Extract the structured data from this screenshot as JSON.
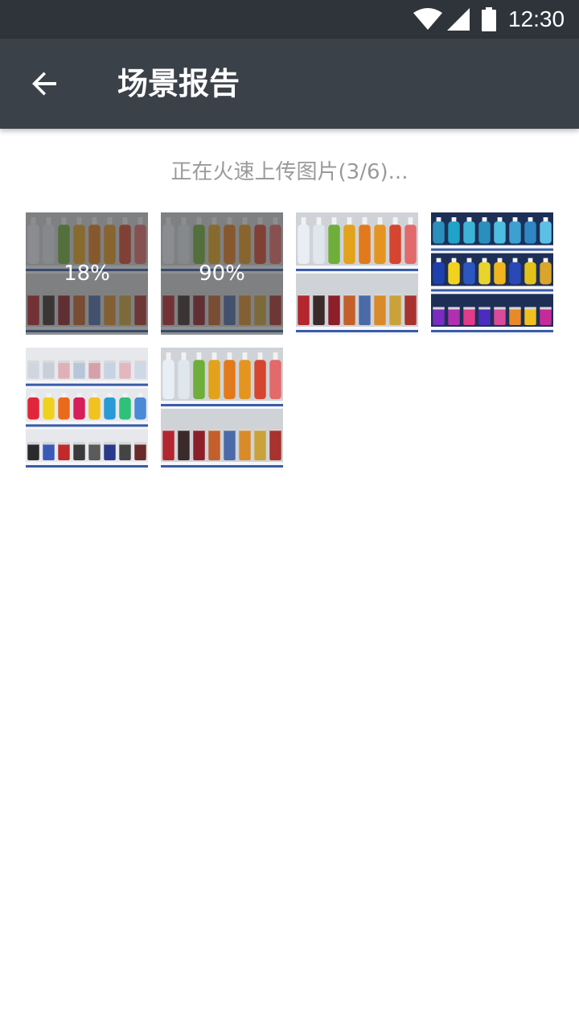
{
  "status_bar": {
    "time": "12:30",
    "icons": [
      "wifi-icon",
      "cell-signal-icon",
      "battery-icon"
    ]
  },
  "app_bar": {
    "back_icon": "arrow-back-icon",
    "title": "场景报告",
    "background": "#3b4149"
  },
  "upload": {
    "status_text": "正在火速上传图片(3/6)..."
  },
  "thumbnails": [
    {
      "scene": "shelf-juice",
      "progress_label": "18%",
      "progress": 0.18
    },
    {
      "scene": "shelf-juice",
      "progress_label": "90%",
      "progress": 0.9
    },
    {
      "scene": "shelf-juice",
      "progress": null
    },
    {
      "scene": "shelf-water",
      "progress": null
    },
    {
      "scene": "shelf-sports",
      "progress": null
    },
    {
      "scene": "shelf-juice",
      "progress": null
    }
  ],
  "colors": {
    "status_bar": "#2f343b",
    "app_bar": "#3b4149",
    "status_text": "#9a9a9a"
  }
}
